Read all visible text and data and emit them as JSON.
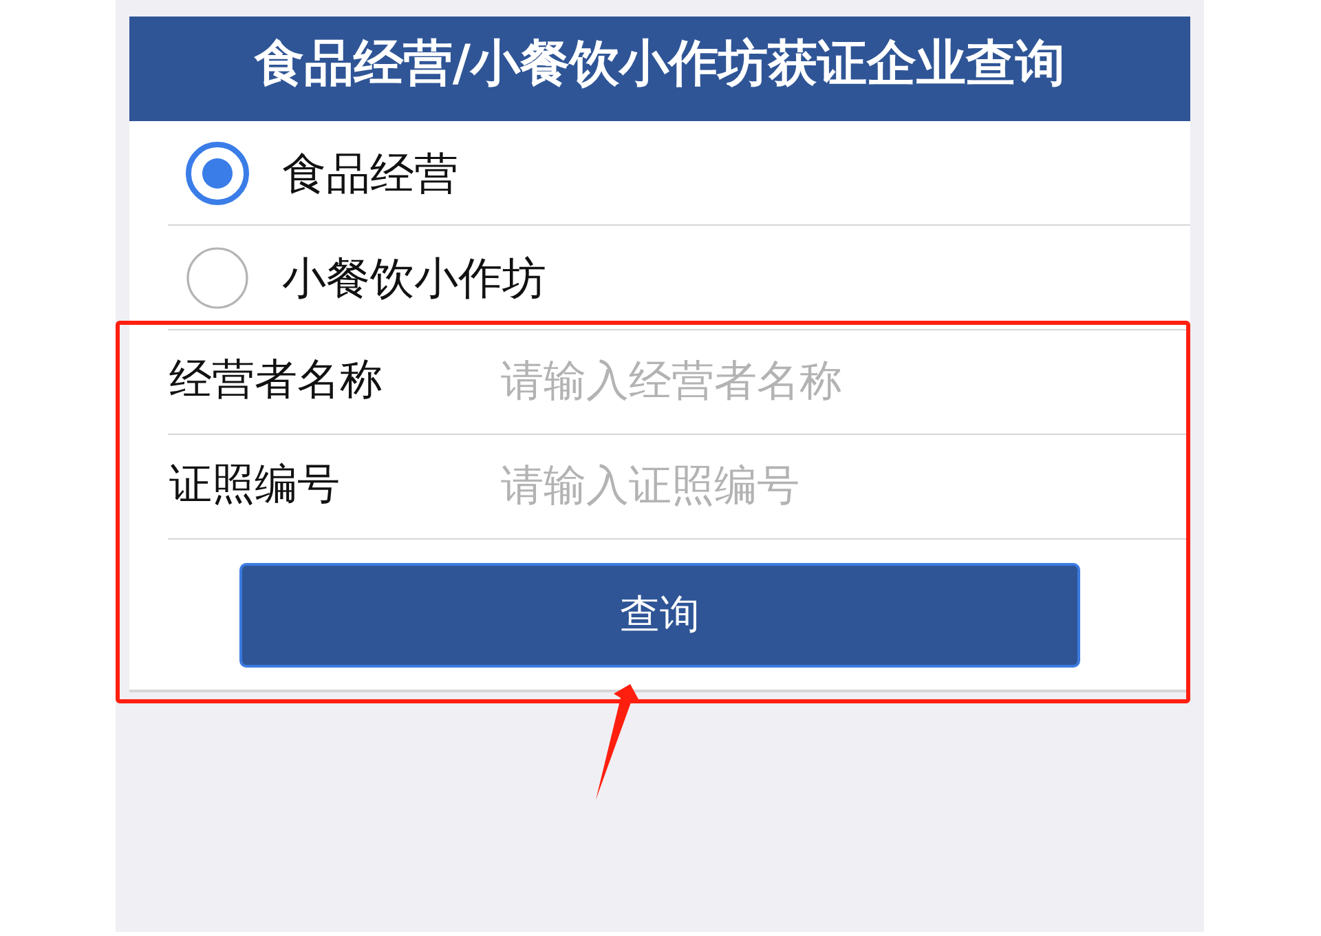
{
  "header": {
    "title": "食品经营/小餐饮小作坊获证企业查询"
  },
  "license_types": [
    {
      "label": "食品经营",
      "selected": true
    },
    {
      "label": "小餐饮小作坊",
      "selected": false
    }
  ],
  "form": {
    "highlighted": true,
    "fields": [
      {
        "label": "经营者名称",
        "placeholder": "请输入经营者名称"
      },
      {
        "label": "证照编号",
        "placeholder": "请输入证照编号"
      }
    ],
    "submit_button": {
      "label": "查询"
    }
  }
}
